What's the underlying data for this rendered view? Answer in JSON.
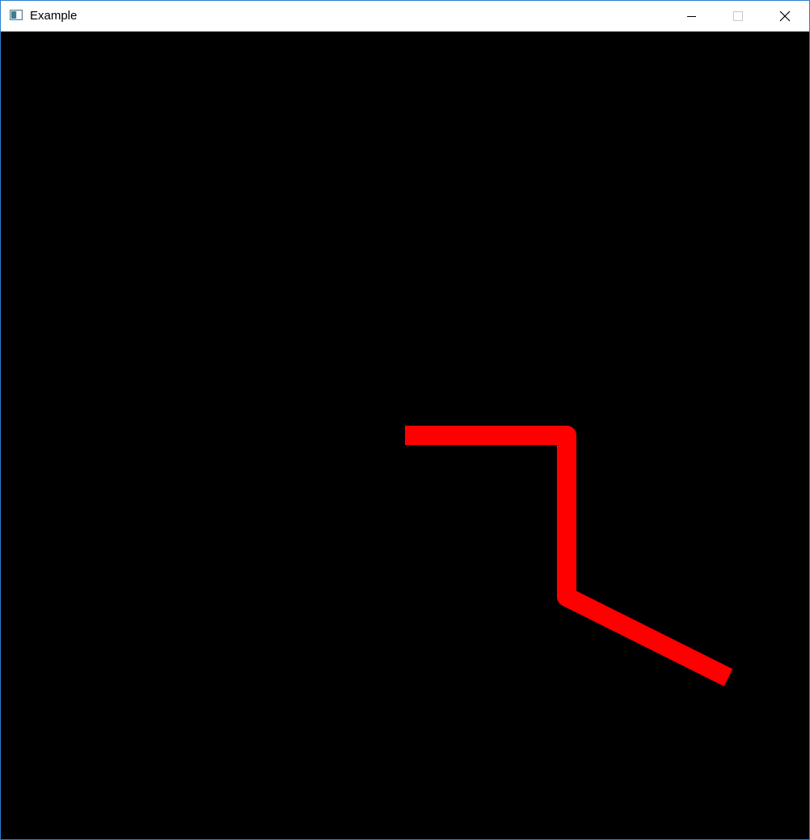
{
  "window": {
    "title": "Example",
    "controls": {
      "minimize_icon": "minimize-icon",
      "maximize_icon": "maximize-icon",
      "close_icon": "close-icon"
    }
  },
  "canvas": {
    "background": "#000000",
    "polyline": {
      "color": "#ff0000",
      "joins": "round"
    }
  }
}
